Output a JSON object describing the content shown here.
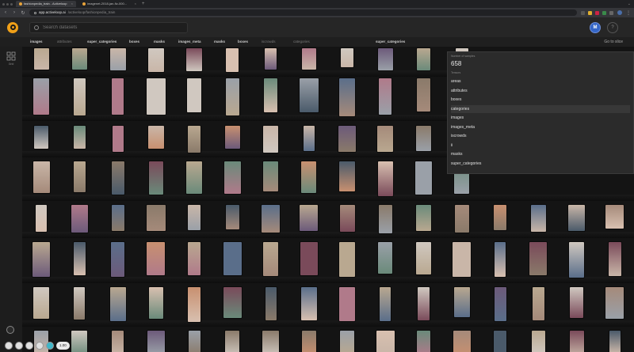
{
  "browser": {
    "tabs": [
      {
        "label": "fashionpedia_train - Activeloop",
        "active": true
      },
      {
        "label": "imagenet-2018-jan-fiz-000...",
        "active": false
      }
    ],
    "url_host": "app.activeloop.ai",
    "url_path": "/activeloop/fashionpedia_train",
    "new_tab": "+",
    "window_menu": "⌄"
  },
  "header": {
    "search_placeholder": "Search datasets",
    "user_initial": "M",
    "help_label": "?"
  },
  "tables": {
    "items": [
      "images",
      "attributes",
      "super_categories",
      "boxes",
      "masks",
      "images_meta",
      "masks",
      "boxes",
      "iscrowds",
      "categories",
      "super_categories"
    ],
    "goto_label": "Go to slice"
  },
  "leftrail": {
    "grid_label": "Grid"
  },
  "dropdown": {
    "caption": "Number of samples",
    "count": "658",
    "subcaption": "Tensors",
    "items": [
      "areas",
      "attributes",
      "boxes",
      "categories",
      "images",
      "images_meta",
      "iscrowds",
      "ii",
      "masks",
      "super_categories"
    ],
    "highlighted_index": 3
  },
  "controls": {
    "zoom": "1.00"
  },
  "colors": {
    "accent_logo": "#f0a018",
    "avatar": "#3466c8",
    "highlight_control": "#3fb6c8"
  }
}
